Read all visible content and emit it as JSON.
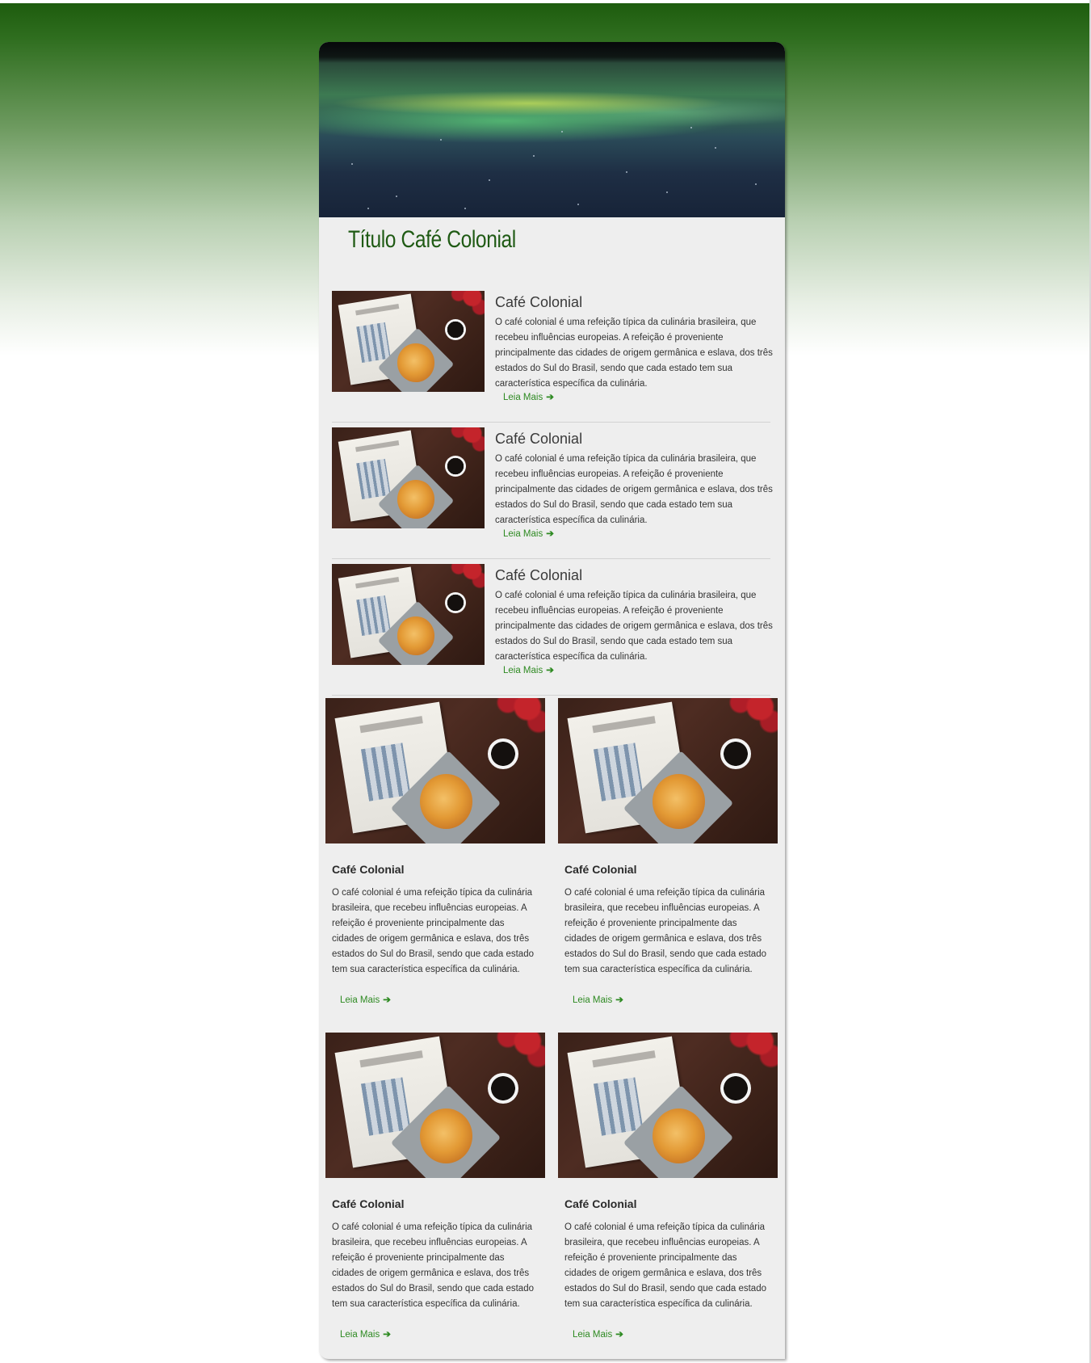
{
  "page": {
    "title": "Título Café Colonial"
  },
  "read_more": {
    "label": "Leia Mais",
    "arrow": "➔"
  },
  "list_items": [
    {
      "title": "Café Colonial",
      "text": "O café colonial é uma refeição típica da culinária brasileira, que recebeu influências europeias. A refeição é proveniente principalmente das cidades de origem germânica e eslava, dos três estados do Sul do Brasil, sendo que cada estado tem sua característica específica da culinária."
    },
    {
      "title": "Café Colonial",
      "text": "O café colonial é uma refeição típica da culinária brasileira, que recebeu influências europeias. A refeição é proveniente principalmente das cidades de origem germânica e eslava, dos três estados do Sul do Brasil, sendo que cada estado tem sua característica específica da culinária."
    },
    {
      "title": "Café Colonial",
      "text": "O café colonial é uma refeição típica da culinária brasileira, que recebeu influências europeias. A refeição é proveniente principalmente das cidades de origem germânica e eslava, dos três estados do Sul do Brasil, sendo que cada estado tem sua característica específica da culinária."
    }
  ],
  "grid_cards": [
    {
      "title": "Café Colonial",
      "text": "O café colonial é uma refeição típica da culinária brasileira, que recebeu influências europeias. A refeição é proveniente principalmente das cidades de origem germânica e eslava, dos três estados do Sul do Brasil, sendo que cada estado tem sua característica específica da culinária."
    },
    {
      "title": "Café Colonial",
      "text": "O café colonial é uma refeição típica da culinária brasileira, que recebeu influências europeias. A refeição é proveniente principalmente das cidades de origem germânica e eslava, dos três estados do Sul do Brasil, sendo que cada estado tem sua característica específica da culinária."
    },
    {
      "title": "Café Colonial",
      "text": "O café colonial é uma refeição típica da culinária brasileira, que recebeu influências europeias. A refeição é proveniente principalmente das cidades de origem germânica e eslava, dos três estados do Sul do Brasil, sendo que cada estado tem sua característica específica da culinária."
    },
    {
      "title": "Café Colonial",
      "text": "O café colonial é uma refeição típica da culinária brasileira, que recebeu influências europeias. A refeição é proveniente principalmente das cidades de origem germânica e eslava, dos três estados do Sul do Brasil, sendo que cada estado tem sua característica específica da culinária."
    }
  ],
  "colors": {
    "header_green": "#1e5c0e",
    "title_green": "#1f5a14",
    "link_green": "#2e8a22",
    "card_background": "#eeeeee"
  }
}
